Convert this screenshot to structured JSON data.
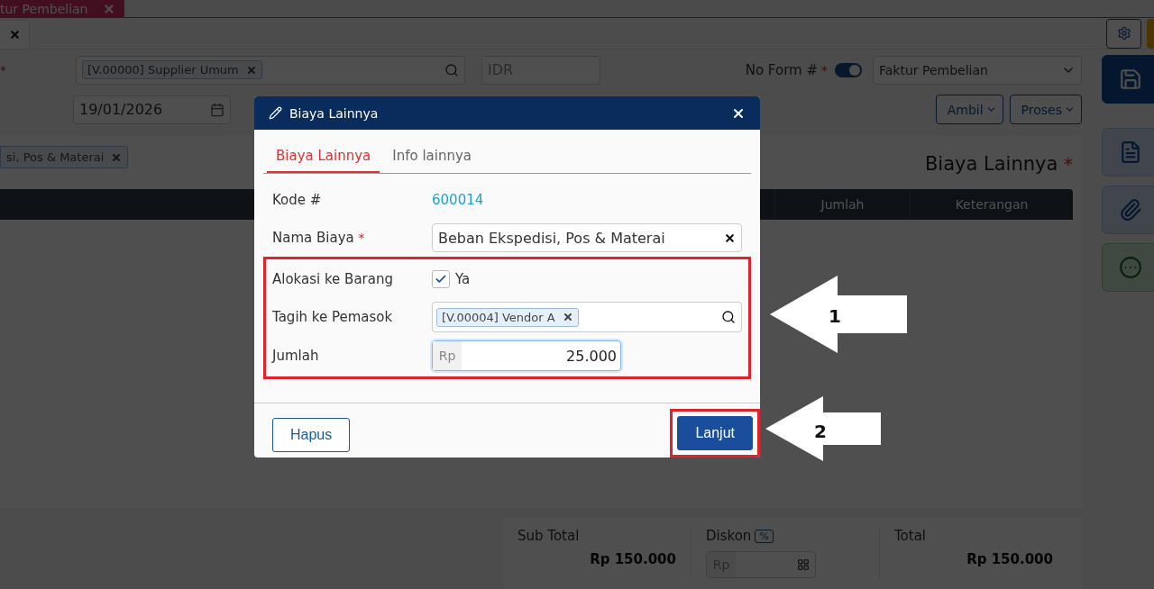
{
  "doc_tab": {
    "label": "tur Pembelian"
  },
  "form": {
    "supplier": {
      "mark": "*",
      "tag": "[V.00000] Supplier Umum"
    },
    "currency": {
      "value": "IDR"
    },
    "form_no": {
      "label": "No Form #",
      "mark": "*",
      "toggle_on": true
    },
    "form_type": {
      "value": "Faktur Pembelian"
    },
    "date": {
      "value": "19/01/2026"
    },
    "buttons": [
      "Ambil",
      "Proses"
    ]
  },
  "cost_card": {
    "tag": "si, Pos & Materai",
    "title": "Biaya Lainnya",
    "mark": "*",
    "columns": [
      "Jumlah",
      "Keterangan"
    ]
  },
  "summary": {
    "subtotal": {
      "label": "Sub Total",
      "value": "Rp 150.000"
    },
    "discount": {
      "label": "Diskon",
      "unit": "%",
      "prefix": "Rp"
    },
    "total": {
      "label": "Total",
      "value": "Rp 150.000"
    }
  },
  "dialog": {
    "title": "Biaya Lainnya",
    "tabs": [
      {
        "label": "Biaya Lainnya",
        "selected": true
      },
      {
        "label": "Info lainnya",
        "selected": false
      }
    ],
    "code": {
      "label": "Kode #",
      "value": "600014"
    },
    "cost_name": {
      "label": "Nama Biaya",
      "mark": "*",
      "value": "Beban Ekspedisi, Pos & Materai"
    },
    "allocate": {
      "label": "Alokasi ke Barang",
      "checked": true,
      "option": "Ya"
    },
    "bill_to": {
      "label": "Tagih ke Pemasok",
      "tag": "[V.00004] Vendor A"
    },
    "amount": {
      "label": "Jumlah",
      "prefix": "Rp",
      "value": "25.000"
    },
    "buttons": [
      {
        "label": "Hapus",
        "kind": "secondary"
      },
      {
        "label": "Lanjut",
        "kind": "primary"
      }
    ]
  },
  "callouts": [
    "1",
    "2"
  ]
}
